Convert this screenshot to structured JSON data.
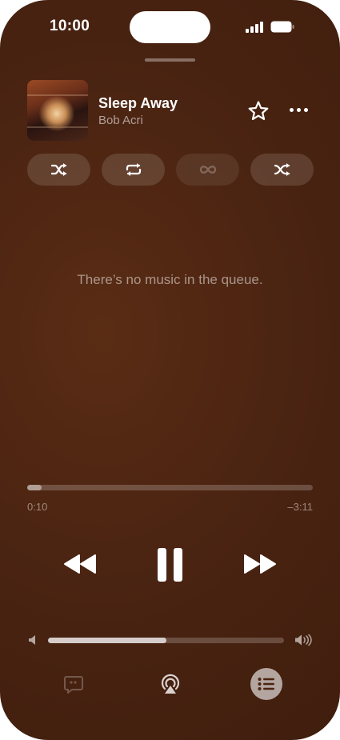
{
  "status": {
    "time": "10:00"
  },
  "now_playing": {
    "title": "Sleep Away",
    "artist": "Bob Acri",
    "artwork_icon": "album-artwork"
  },
  "modes": [
    {
      "name": "shuffle",
      "icon": "shuffle-icon",
      "enabled": true
    },
    {
      "name": "repeat",
      "icon": "repeat-icon",
      "enabled": true
    },
    {
      "name": "autoplay",
      "icon": "infinity-icon",
      "enabled": false
    },
    {
      "name": "crossfade",
      "icon": "crossfade-icon",
      "enabled": true
    }
  ],
  "queue": {
    "empty_message": "There’s no music in the queue."
  },
  "progress": {
    "elapsed": "0:10",
    "remaining": "–3:11",
    "fraction": 0.05
  },
  "volume": {
    "fraction": 0.5
  },
  "bottom_bar": {
    "lyrics_icon": "lyrics-bubble-icon",
    "airplay_icon": "airplay-icon",
    "queue_icon": "queue-list-icon"
  },
  "colors": {
    "accent": "#4b2412",
    "text_dim": "rgba(255,255,255,0.5)"
  }
}
